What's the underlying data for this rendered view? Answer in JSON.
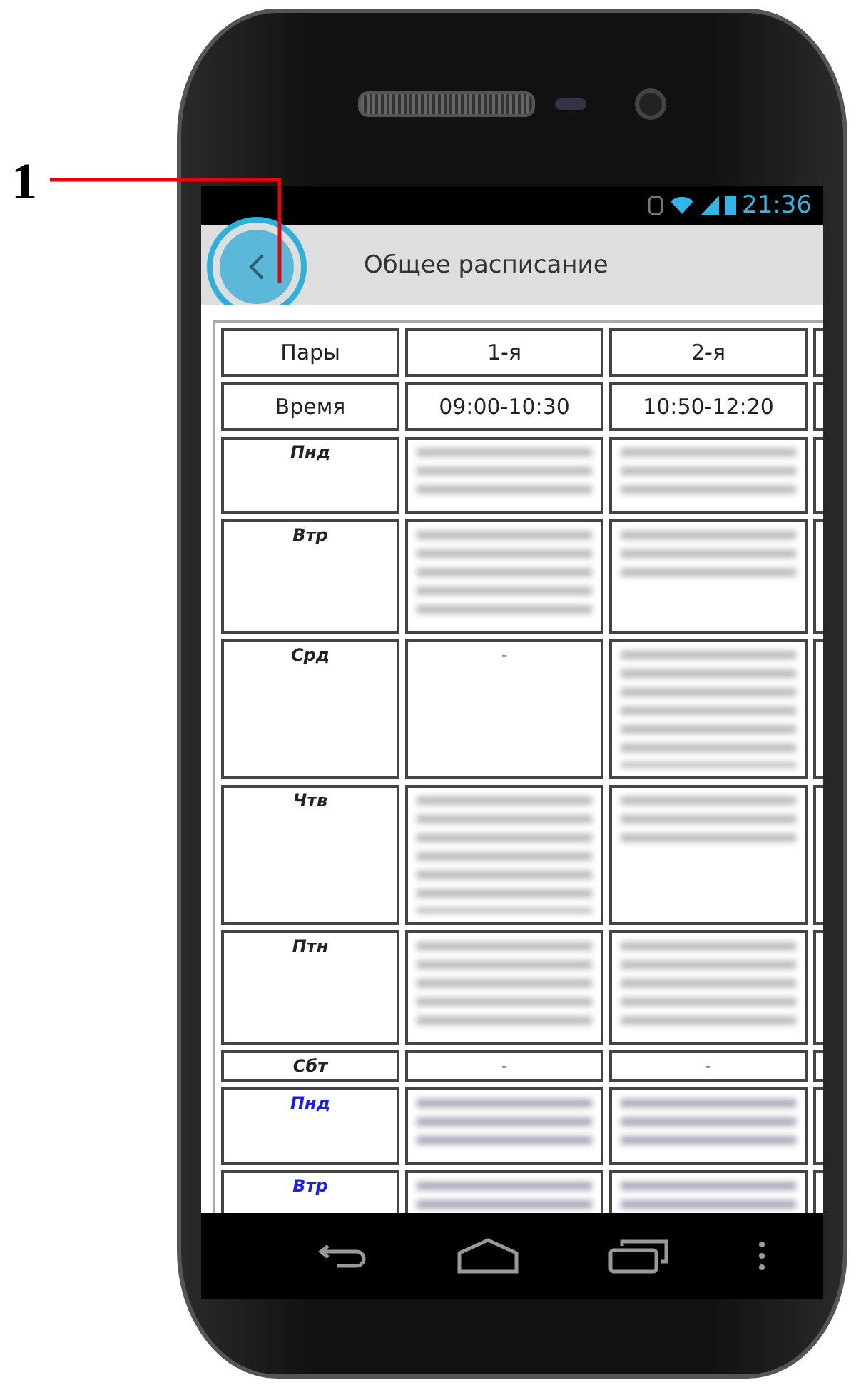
{
  "callout": {
    "label": "1"
  },
  "status_bar": {
    "time": "21:36"
  },
  "app_bar": {
    "title": "Общее расписание",
    "back_highlighted": true
  },
  "table": {
    "header_row": {
      "label": "Пары",
      "cells": [
        "1-я",
        "2-я"
      ]
    },
    "time_row": {
      "label": "Время",
      "cells": [
        "09:00-10:30",
        "10:50-12:20"
      ]
    },
    "rows": [
      {
        "day": "Пнд",
        "highlighted": false,
        "cells": [
          {
            "kind": "short"
          },
          {
            "kind": "short"
          }
        ]
      },
      {
        "day": "Втр",
        "highlighted": false,
        "cells": [
          {
            "kind": "medium"
          },
          {
            "kind": "short"
          }
        ]
      },
      {
        "day": "Срд",
        "highlighted": false,
        "cells": [
          {
            "kind": "text",
            "text": "-"
          },
          {
            "kind": "long"
          }
        ]
      },
      {
        "day": "Чтв",
        "highlighted": false,
        "cells": [
          {
            "kind": "long"
          },
          {
            "kind": "short"
          }
        ]
      },
      {
        "day": "Птн",
        "highlighted": false,
        "cells": [
          {
            "kind": "medium"
          },
          {
            "kind": "medium"
          }
        ]
      },
      {
        "day": "Сбт",
        "highlighted": false,
        "cells": [
          {
            "kind": "text",
            "text": "-"
          },
          {
            "kind": "text",
            "text": "-"
          }
        ]
      },
      {
        "day": "Пнд",
        "highlighted": true,
        "cells": [
          {
            "kind": "short"
          },
          {
            "kind": "short"
          }
        ]
      },
      {
        "day": "Втр",
        "highlighted": true,
        "cells": [
          {
            "kind": "medium"
          },
          {
            "kind": "medium"
          }
        ]
      }
    ]
  }
}
